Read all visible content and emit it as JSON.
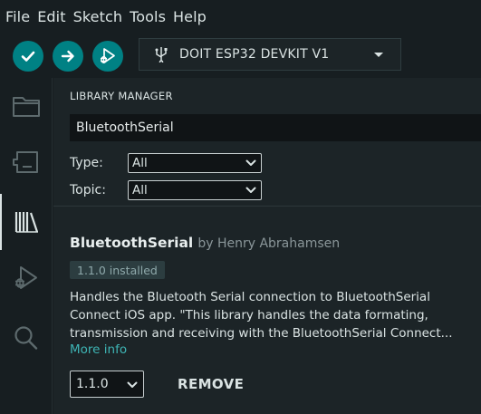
{
  "menubar": {
    "items": [
      "File",
      "Edit",
      "Sketch",
      "Tools",
      "Help"
    ]
  },
  "toolbar": {
    "verify_icon": "checkmark-icon",
    "upload_icon": "arrow-right-icon",
    "debug_icon": "debug-icon",
    "board_icon": "usb-icon",
    "board_name": "DOIT ESP32 DEVKIT V1",
    "accent": "#008184"
  },
  "sidebar": {
    "items": [
      {
        "icon": "folder-icon"
      },
      {
        "icon": "board-manager-icon"
      },
      {
        "icon": "library-icon",
        "active": true
      },
      {
        "icon": "debug-icon"
      },
      {
        "icon": "search-icon"
      }
    ]
  },
  "library_manager": {
    "title": "LIBRARY MANAGER",
    "search_value": "BluetoothSerial",
    "type_label": "Type:",
    "type_value": "All",
    "topic_label": "Topic:",
    "topic_value": "All"
  },
  "library": {
    "name": "BluetoothSerial",
    "author": "by Henry Abrahamsen",
    "installed_badge": "1.1.0 installed",
    "description_lines": [
      "Handles the Bluetooth Serial connection to BluetoothSerial",
      "Connect iOS app. \"This library handles the data formating,",
      "transmission and receiving with the BluetoothSerial Connect..."
    ],
    "more_info": "More info",
    "version_value": "1.1.0",
    "remove_label": "REMOVE"
  }
}
